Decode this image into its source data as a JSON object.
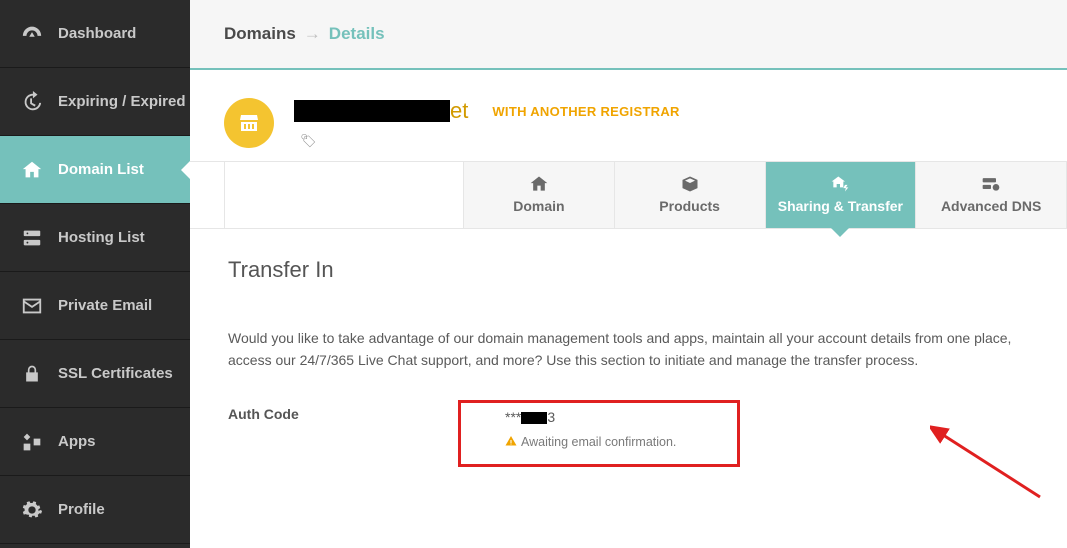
{
  "sidebar": {
    "items": [
      {
        "label": "Dashboard"
      },
      {
        "label": "Expiring / Expired"
      },
      {
        "label": "Domain List"
      },
      {
        "label": "Hosting List"
      },
      {
        "label": "Private Email"
      },
      {
        "label": "SSL Certificates"
      },
      {
        "label": "Apps"
      },
      {
        "label": "Profile"
      }
    ]
  },
  "breadcrumb": {
    "root": "Domains",
    "arrow": "→",
    "current": "Details"
  },
  "domain": {
    "suffix": "et",
    "registrar": "WITH ANOTHER REGISTRAR"
  },
  "tabs": [
    {
      "label": "Domain"
    },
    {
      "label": "Products"
    },
    {
      "label": "Sharing & Transfer"
    },
    {
      "label": "Advanced DNS"
    }
  ],
  "section": {
    "title": "Transfer In",
    "desc": "Would you like to take advantage of our domain management tools and apps, maintain all your account details from one place, access our 24/7/365 Live Chat support, and more? Use this section to initiate and manage the transfer process."
  },
  "auth": {
    "label": "Auth Code",
    "prefix": "***",
    "suffix": "3",
    "status": "Awaiting email confirmation."
  }
}
